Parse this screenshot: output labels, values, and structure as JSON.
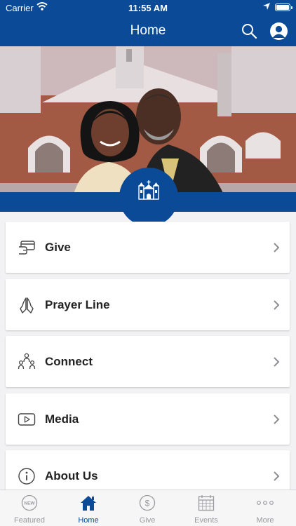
{
  "status": {
    "carrier": "Carrier",
    "time": "11:55 AM"
  },
  "header": {
    "title": "Home"
  },
  "colors": {
    "brand": "#0a4a97",
    "icon": "#444444",
    "tab_inactive": "#9a9a9f"
  },
  "hero": {
    "badge_icon": "church-icon"
  },
  "menu": {
    "items": [
      {
        "label": "Give",
        "icon": "card-icon"
      },
      {
        "label": "Prayer Line",
        "icon": "praying-hands-icon"
      },
      {
        "label": "Connect",
        "icon": "people-icon"
      },
      {
        "label": "Media",
        "icon": "play-icon"
      },
      {
        "label": "About Us",
        "icon": "info-icon"
      }
    ]
  },
  "tabs": [
    {
      "label": "Featured",
      "icon": "new-badge-icon",
      "active": false
    },
    {
      "label": "Home",
      "icon": "home-icon",
      "active": true
    },
    {
      "label": "Give",
      "icon": "dollar-icon",
      "active": false
    },
    {
      "label": "Events",
      "icon": "calendar-icon",
      "active": false
    },
    {
      "label": "More",
      "icon": "more-icon",
      "active": false
    }
  ]
}
